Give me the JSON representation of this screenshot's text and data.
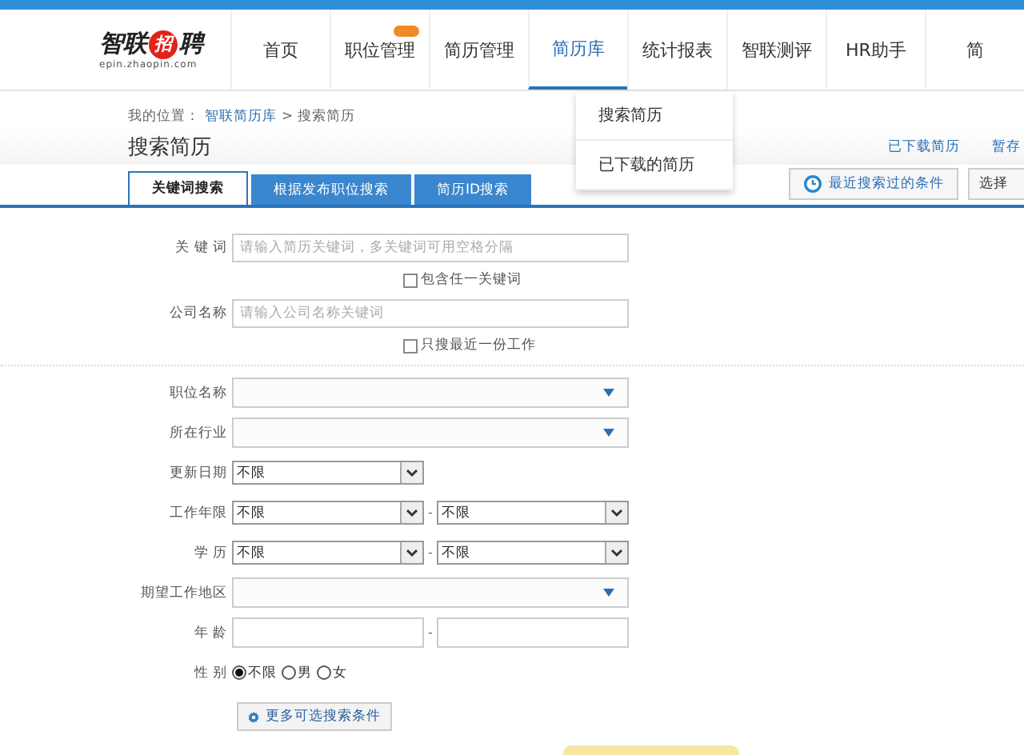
{
  "header": {
    "logo": {
      "name": "智联",
      "mark": "招",
      "tail": "聘",
      "url": "epin.zhaopin.com"
    },
    "nav": [
      {
        "label": "首页",
        "selected": false,
        "badge": false
      },
      {
        "label": "职位管理",
        "selected": false,
        "badge": true
      },
      {
        "label": "简历管理",
        "selected": false,
        "badge": false
      },
      {
        "label": "简历库",
        "selected": true,
        "badge": false
      },
      {
        "label": "统计报表",
        "selected": false,
        "badge": false
      },
      {
        "label": "智联测评",
        "selected": false,
        "badge": false
      },
      {
        "label": "HR助手",
        "selected": false,
        "badge": false
      },
      {
        "label": "简",
        "selected": false,
        "badge": false
      }
    ],
    "dropdown": [
      "搜索简历",
      "已下载的简历"
    ]
  },
  "breadcrumb": {
    "prefix": "我的位置：",
    "link": "智联简历库",
    "current": "> 搜索简历"
  },
  "page_title": "搜索简历",
  "top_links": [
    "已下载简历",
    "暂存"
  ],
  "tabs": [
    {
      "label": "关键词搜索",
      "selected": true
    },
    {
      "label": "根据发布职位搜索",
      "selected": false
    },
    {
      "label": "简历ID搜索",
      "selected": false
    }
  ],
  "recent_button": "最近搜索过的条件",
  "select_button": "选择",
  "form": [
    {
      "kind": "text",
      "label": "关 键 词",
      "placeholder": "请输入简历关键词，多关键词可用空格分隔",
      "option": {
        "label": "包含任一关键词",
        "checked": false
      }
    },
    {
      "kind": "text",
      "label": "公司名称",
      "placeholder": "请输入公司名称关键词",
      "option": {
        "label": "只搜最近一份工作",
        "checked": false
      }
    },
    {
      "kind": "divider"
    },
    {
      "kind": "combo",
      "label": "职位名称"
    },
    {
      "kind": "combo",
      "label": "所在行业"
    },
    {
      "kind": "select",
      "label": "更新日期",
      "values": [
        "不限"
      ]
    },
    {
      "kind": "select",
      "label": "工作年限",
      "values": [
        "不限",
        "不限"
      ],
      "separator": "-"
    },
    {
      "kind": "select",
      "label": "学 历",
      "values": [
        "不限",
        "不限"
      ],
      "separator": "-"
    },
    {
      "kind": "combo",
      "label": "期望工作地区"
    },
    {
      "kind": "range",
      "label": "年 龄",
      "separator": "-"
    },
    {
      "kind": "radio",
      "label": "性 别",
      "choices": [
        {
          "label": "不限",
          "selected": true
        },
        {
          "label": "男",
          "selected": false
        },
        {
          "label": "女",
          "selected": false
        }
      ]
    }
  ],
  "more_button": "更多可选搜索条件"
}
